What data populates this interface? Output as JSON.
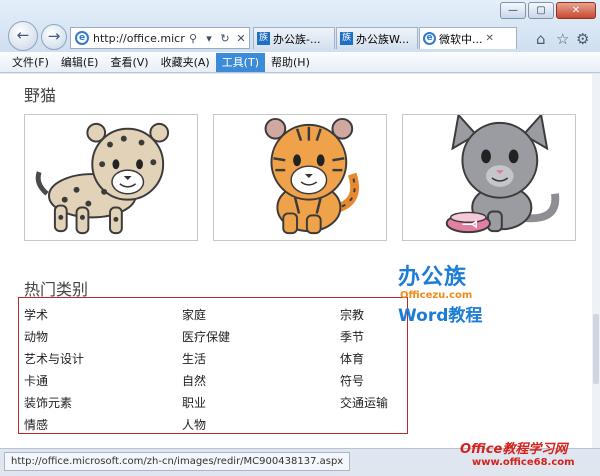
{
  "browser": {
    "address_url": "http://office.micr",
    "tabs": [
      {
        "label": "办公族-..."
      },
      {
        "label": "办公族W..."
      },
      {
        "label": "微软中..."
      }
    ],
    "window_controls": {
      "minimize": "—",
      "maximize": "▢",
      "close": "✕"
    }
  },
  "menubar": {
    "items": [
      {
        "label": "文件(F)"
      },
      {
        "label": "编辑(E)"
      },
      {
        "label": "查看(V)"
      },
      {
        "label": "收藏夹(A)"
      },
      {
        "label": "工具(T)"
      },
      {
        "label": "帮助(H)"
      }
    ],
    "active_index": 4
  },
  "content": {
    "section_title": "野猫",
    "popular_title": "热门类别",
    "popular_categories": [
      [
        "学术",
        "家庭",
        "宗教"
      ],
      [
        "动物",
        "医疗保健",
        "季节"
      ],
      [
        "艺术与设计",
        "生活",
        "体育"
      ],
      [
        "卡通",
        "自然",
        "符号"
      ],
      [
        "装饰元素",
        "职业",
        "交通运输"
      ],
      [
        "情感",
        "人物",
        ""
      ]
    ]
  },
  "watermark": {
    "brand": "办公族",
    "brand_tail": "族",
    "url": "Officezu.com",
    "subtitle": "Word教程",
    "bottom_title": "Office教程学习网",
    "bottom_url": "www.office68.com"
  },
  "status": {
    "url": "http://office.microsoft.com/zh-cn/images/redir/MC900438137.aspx"
  },
  "colors": {
    "accent": "#3b8bd9",
    "highlight_box": "#c0262a",
    "logo_blue": "#1c7dd6",
    "logo_orange": "#f18a1c"
  }
}
